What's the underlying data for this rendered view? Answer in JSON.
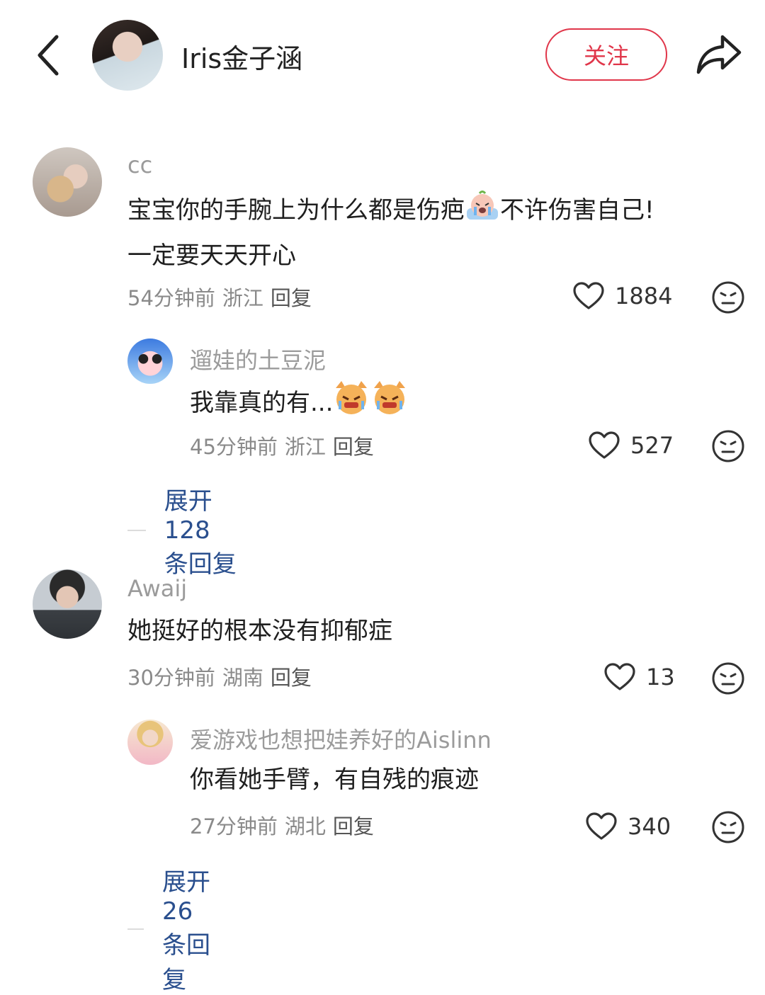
{
  "header": {
    "title": "Iris金子涵",
    "follow_label": "关注"
  },
  "comments": [
    {
      "name": "cc",
      "text_line1_a": "宝宝你的手腕上为什么都是伤疤",
      "text_line1_b": "不许伤害自己!",
      "text_line2": "一定要天天开心",
      "time": "54分钟前",
      "location": "浙江",
      "reply_label": "回复",
      "likes": "1884",
      "replies": [
        {
          "name": "遛娃的土豆泥",
          "text": "我靠真的有...",
          "time": "45分钟前",
          "location": "浙江",
          "reply_label": "回复",
          "likes": "527"
        }
      ],
      "expand_label": "展开 128 条回复"
    },
    {
      "name": "Awaij",
      "text_line1": "她挺好的根本没有抑郁症",
      "time": "30分钟前",
      "location": "湖南",
      "reply_label": "回复",
      "likes": "13",
      "replies": [
        {
          "name": "爱游戏也想把娃养好的Aislinn",
          "text": "你看她手臂，有自残的痕迹",
          "time": "27分钟前",
          "location": "湖北",
          "reply_label": "回复",
          "likes": "340"
        }
      ],
      "expand_label": "展开 26 条回复"
    }
  ],
  "colors": {
    "accent_red": "#e0364a",
    "expand_blue": "#2a4f8e",
    "meta_gray": "#8a8a8a"
  }
}
